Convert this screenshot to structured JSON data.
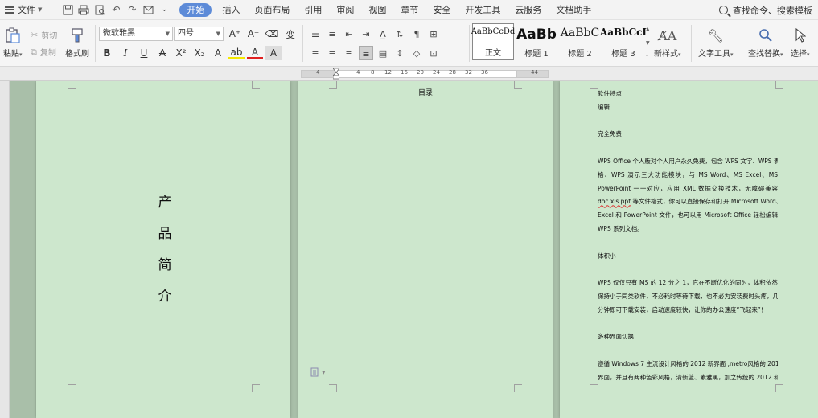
{
  "menu": {
    "file_label": "文件",
    "tabs": [
      "开始",
      "插入",
      "页面布局",
      "引用",
      "审阅",
      "视图",
      "章节",
      "安全",
      "开发工具",
      "云服务",
      "文档助手"
    ],
    "search_label": "查找命令、搜索模板"
  },
  "ribbon": {
    "paste": "粘贴",
    "cut": "剪切",
    "copy": "复制",
    "format_painter": "格式刷",
    "font_name": "微软雅黑",
    "font_size": "四号",
    "styles": [
      {
        "sample": "AaBbCcDd",
        "name": "正文"
      },
      {
        "sample": "AaBb",
        "name": "标题 1"
      },
      {
        "sample": "AaBbC",
        "name": "标题 2"
      },
      {
        "sample": "AaBbCcI",
        "name": "标题 3"
      }
    ],
    "new_style": "新样式",
    "text_tools": "文字工具",
    "find_replace": "查找替换",
    "select": "选择"
  },
  "ruler": {
    "ticks": [
      "4",
      "4",
      "8",
      "12",
      "16",
      "20",
      "24",
      "28",
      "32",
      "36",
      "44"
    ]
  },
  "page1": {
    "title_chars": [
      "产",
      "品",
      "简",
      "介"
    ]
  },
  "page2": {
    "toc_title": "目录"
  },
  "page3": {
    "l1": "软件特点",
    "l2": "编辑",
    "h1": "完全免费",
    "p1a": "WPS Office 个人版对个人用户永久免费，包含 WPS 文字、WPS 表",
    "p1b": "格、WPS 演示三大功能模块，与 MS Word、MS Excel、MS",
    "p1c": "PowerPoint 一一对应，应用 XML 数据交换技术，无障碍兼容",
    "p1d": "等文件格式，你可以直接保存和打开 Microsoft Word、",
    "p1d_u": "doc.xls.ppt",
    "p1e": "Excel 和 PowerPoint 文件，也可以用 Microsoft Office 轻松编辑",
    "p1f": "WPS 系列文档。",
    "h2": "体积小",
    "p2a": "WPS 仅仅只有 MS 的 12 分之 1，它在不断优化的同时，体积依然",
    "p2b": "保持小于同类软件，不必耗时等待下载，也不必为安装费时头疼，几",
    "p2c": "分钟即可下载安装，启动速度较快，让你的办公速度“飞起来”！",
    "h3": "多种界面切换",
    "p3a": "遵循 Windows 7 主流设计风格的 2012 新界面 ,metro风格的 2013",
    "p3b": "界面，并且有两种色彩风格，清新蓝、素雅黑，加之传统的 2012 和"
  },
  "colors": {
    "page_bg": "#cde7cd",
    "tab_active": "#5d8bd8",
    "desk_bg": "#a9bfa9"
  }
}
